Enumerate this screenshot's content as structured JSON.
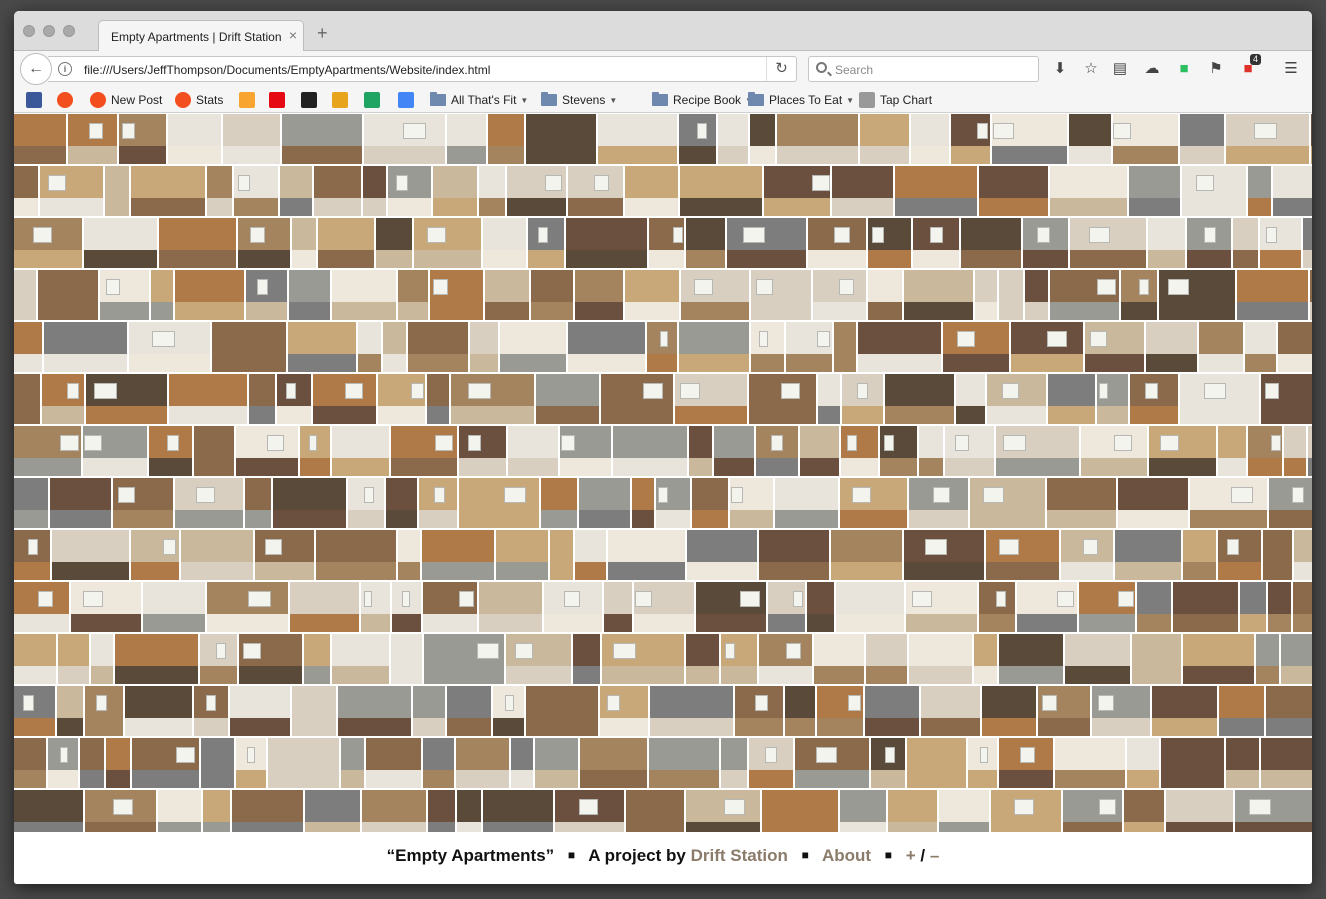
{
  "browser": {
    "tab_title": "Empty Apartments | Drift Station",
    "tab_close": "×",
    "new_tab": "+",
    "url": "file:///Users/JeffThompson/Documents/EmptyApartments/Website/index.html",
    "search_placeholder": "Search",
    "badge_count": "4",
    "toolbar_icons": [
      "download-icon",
      "bookmark-star-icon",
      "reader-icon",
      "cloud-icon",
      "evernote-icon",
      "pin-icon",
      "extension-icon",
      "menu-icon"
    ]
  },
  "bookmarks": [
    {
      "label": "",
      "icon": "facebook-icon",
      "color": "#3b5998"
    },
    {
      "label": "",
      "icon": "circle-icon",
      "color": "#f24e1e"
    },
    {
      "label": "New Post",
      "icon": "circle-icon",
      "color": "#f24e1e"
    },
    {
      "label": "Stats",
      "icon": "circle-icon",
      "color": "#f24e1e"
    },
    {
      "label": "",
      "icon": "square-icon",
      "color": "#f7a530"
    },
    {
      "label": "",
      "icon": "netflix-icon",
      "color": "#e50914"
    },
    {
      "label": "",
      "icon": "github-icon",
      "color": "#222222"
    },
    {
      "label": "",
      "icon": "wu-icon",
      "color": "#e8a31c"
    },
    {
      "label": "",
      "icon": "drive-icon",
      "color": "#1fa463"
    },
    {
      "label": "",
      "icon": "google-icon",
      "color": "#4285f4"
    },
    {
      "label": "All That's Fit",
      "icon": "folder-icon",
      "folder": true
    },
    {
      "label": "Stevens",
      "icon": "folder-icon",
      "folder": true
    },
    {
      "label": "Recipe Book",
      "icon": "folder-icon",
      "folder": true
    },
    {
      "label": "Places To Eat",
      "icon": "folder-icon",
      "folder": true
    },
    {
      "label": "Tap Chart",
      "icon": "tap-icon",
      "folder": false
    }
  ],
  "footer": {
    "title": "“Empty Apartments”",
    "project_by": "A project by",
    "studio": "Drift Station",
    "about": "About",
    "plus": "+",
    "slash": "/",
    "minus": "–",
    "separator": "■"
  },
  "gallery": {
    "rows": 14,
    "description_palette": [
      "#c9b89c",
      "#8a6a4a",
      "#e8e4dc",
      "#a4845e",
      "#5a4a3a",
      "#d8cfc0",
      "#b07a48",
      "#7d7d7d",
      "#eee8dc",
      "#6b5040",
      "#c8a878",
      "#9a9a94"
    ]
  }
}
